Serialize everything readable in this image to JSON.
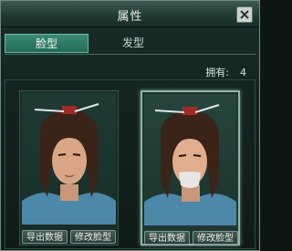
{
  "window": {
    "title": "属性"
  },
  "tabs": [
    {
      "label": "脸型",
      "active": true
    },
    {
      "label": "发型",
      "active": false
    }
  ],
  "owned": {
    "label": "拥有:",
    "count": "4"
  },
  "cards": [
    {
      "export_label": "导出数据",
      "modify_label": "修改脸型",
      "selected": false
    },
    {
      "export_label": "导出数据",
      "modify_label": "修改脸型",
      "selected": true
    }
  ],
  "colors": {
    "accent_tab": "#2f7a66",
    "border": "#8fb5a7"
  },
  "icons": {
    "close": "close-icon"
  }
}
